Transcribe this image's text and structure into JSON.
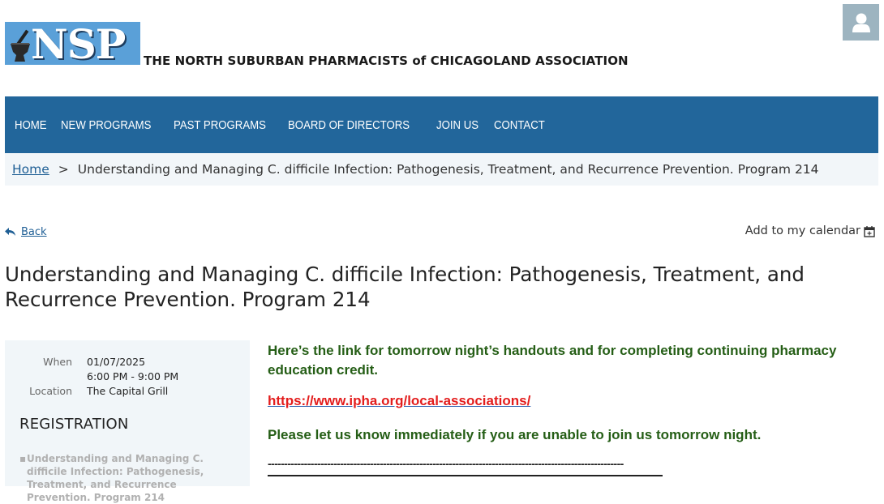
{
  "header": {
    "logo_text": "NSP",
    "org_name": "THE NORTH SUBURBAN PHARMACISTS of CHICAGOLAND ASSOCIATION",
    "avatar_icon": "user-icon"
  },
  "nav": {
    "items": [
      {
        "label": "HOME"
      },
      {
        "label": "NEW PROGRAMS"
      },
      {
        "label": "PAST PROGRAMS"
      },
      {
        "label": "BOARD OF DIRECTORS"
      },
      {
        "label": "JOIN US"
      },
      {
        "label": "CONTACT"
      }
    ]
  },
  "breadcrumb": {
    "home": "Home",
    "separator": ">",
    "current": "Understanding and Managing C. difficile Infection: Pathogenesis, Treatment, and Recurrence Prevention. Program 214"
  },
  "actions": {
    "back": "Back",
    "add_calendar": "Add to my calendar"
  },
  "event": {
    "title": "Understanding and Managing C. difficile Infection: Pathogenesis, Treatment, and Recurrence Prevention. Program 214",
    "when_label": "When",
    "date": "01/07/2025",
    "time": "6:00 PM - 9:00 PM",
    "location_label": "Location",
    "location": "The Capital Grill"
  },
  "registration": {
    "heading": "REGISTRATION",
    "items": [
      {
        "label": "Understanding and Managing C. difficile Infection: Pathogenesis, Treatment, and Recurrence Prevention. Program 214"
      }
    ]
  },
  "content": {
    "paragraph1": "Here’s the link for tomorrow night’s handouts and for completing continuing pharmacy education credit.",
    "link": "https://www.ipha.org/local-associations/",
    "paragraph2": "Please let us know immediately if you are unable to join us tomorrow night.",
    "divider": "------------------------------------------------------------------------------------------------------------"
  },
  "colors": {
    "nav_bg": "#22669b",
    "link_blue": "#1f5f95",
    "content_green": "#255e16",
    "link_red": "#e31d1d",
    "sidebar_bg": "#f1f6f9"
  }
}
